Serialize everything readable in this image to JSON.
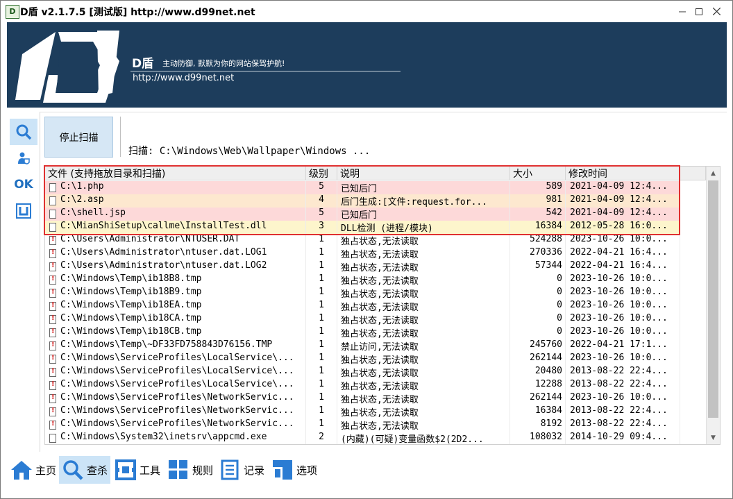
{
  "window": {
    "title": "D盾 v2.1.7.5 [测试版] http://www.d99net.net",
    "icon_text": "D"
  },
  "banner": {
    "logo_letter": "D",
    "brand": "D盾",
    "slogan": "主动防御, 默默为你的网站保驾护航!",
    "url": "http://www.d99net.net"
  },
  "sidebar": {
    "items": [
      {
        "icon": "search-icon",
        "active": true
      },
      {
        "icon": "user-shield-icon",
        "active": false
      },
      {
        "icon": "ok-icon",
        "label": "OK",
        "active": false
      },
      {
        "icon": "frame-icon",
        "active": false
      }
    ]
  },
  "scan": {
    "stop_label": "停止扫描",
    "status": "扫描: C:\\Windows\\Web\\Wallpaper\\Windows ..."
  },
  "table": {
    "columns": [
      "文件 (支持拖放目录和扫描)",
      "级别",
      "说明",
      "大小",
      "修改时间"
    ],
    "rows": [
      {
        "path": "C:\\1.php",
        "level": "5",
        "desc": "已知后门",
        "size": "589",
        "mtime": "2021-04-09 12:4...",
        "bg": "#fdd9d9",
        "warn": false
      },
      {
        "path": "C:\\2.asp",
        "level": "4",
        "desc": "后门生成:[文件:request.for...",
        "size": "981",
        "mtime": "2021-04-09 12:4...",
        "bg": "#fde8cf",
        "warn": false
      },
      {
        "path": "C:\\shell.jsp",
        "level": "5",
        "desc": "已知后门",
        "size": "542",
        "mtime": "2021-04-09 12:4...",
        "bg": "#fdd9d9",
        "warn": false
      },
      {
        "path": "C:\\MianShiSetup\\callme\\InstallTest.dll",
        "level": "3",
        "desc": "DLL检测 (进程/模块)",
        "size": "16384",
        "mtime": "2012-05-28 16:0...",
        "bg": "#fdf5cc",
        "warn": false
      },
      {
        "path": "C:\\Users\\Administrator\\NTUSER.DAT",
        "level": "1",
        "desc": "独占状态,无法读取",
        "size": "524288",
        "mtime": "2023-10-26 10:0...",
        "bg": "#ffffff",
        "warn": true
      },
      {
        "path": "C:\\Users\\Administrator\\ntuser.dat.LOG1",
        "level": "1",
        "desc": "独占状态,无法读取",
        "size": "270336",
        "mtime": "2022-04-21 16:4...",
        "bg": "#ffffff",
        "warn": true
      },
      {
        "path": "C:\\Users\\Administrator\\ntuser.dat.LOG2",
        "level": "1",
        "desc": "独占状态,无法读取",
        "size": "57344",
        "mtime": "2022-04-21 16:4...",
        "bg": "#ffffff",
        "warn": true
      },
      {
        "path": "C:\\Windows\\Temp\\ib18B8.tmp",
        "level": "1",
        "desc": "独占状态,无法读取",
        "size": "0",
        "mtime": "2023-10-26 10:0...",
        "bg": "#ffffff",
        "warn": true
      },
      {
        "path": "C:\\Windows\\Temp\\ib18B9.tmp",
        "level": "1",
        "desc": "独占状态,无法读取",
        "size": "0",
        "mtime": "2023-10-26 10:0...",
        "bg": "#ffffff",
        "warn": true
      },
      {
        "path": "C:\\Windows\\Temp\\ib18EA.tmp",
        "level": "1",
        "desc": "独占状态,无法读取",
        "size": "0",
        "mtime": "2023-10-26 10:0...",
        "bg": "#ffffff",
        "warn": true
      },
      {
        "path": "C:\\Windows\\Temp\\ib18CA.tmp",
        "level": "1",
        "desc": "独占状态,无法读取",
        "size": "0",
        "mtime": "2023-10-26 10:0...",
        "bg": "#ffffff",
        "warn": true
      },
      {
        "path": "C:\\Windows\\Temp\\ib18CB.tmp",
        "level": "1",
        "desc": "独占状态,无法读取",
        "size": "0",
        "mtime": "2023-10-26 10:0...",
        "bg": "#ffffff",
        "warn": true
      },
      {
        "path": "C:\\Windows\\Temp\\~DF33FD758843D76156.TMP",
        "level": "1",
        "desc": "禁止访问,无法读取",
        "size": "245760",
        "mtime": "2022-04-21 17:1...",
        "bg": "#ffffff",
        "warn": true
      },
      {
        "path": "C:\\Windows\\ServiceProfiles\\LocalService\\...",
        "level": "1",
        "desc": "独占状态,无法读取",
        "size": "262144",
        "mtime": "2023-10-26 10:0...",
        "bg": "#ffffff",
        "warn": true
      },
      {
        "path": "C:\\Windows\\ServiceProfiles\\LocalService\\...",
        "level": "1",
        "desc": "独占状态,无法读取",
        "size": "20480",
        "mtime": "2013-08-22 22:4...",
        "bg": "#ffffff",
        "warn": true
      },
      {
        "path": "C:\\Windows\\ServiceProfiles\\LocalService\\...",
        "level": "1",
        "desc": "独占状态,无法读取",
        "size": "12288",
        "mtime": "2013-08-22 22:4...",
        "bg": "#ffffff",
        "warn": true
      },
      {
        "path": "C:\\Windows\\ServiceProfiles\\NetworkServic...",
        "level": "1",
        "desc": "独占状态,无法读取",
        "size": "262144",
        "mtime": "2023-10-26 10:0...",
        "bg": "#ffffff",
        "warn": true
      },
      {
        "path": "C:\\Windows\\ServiceProfiles\\NetworkServic...",
        "level": "1",
        "desc": "独占状态,无法读取",
        "size": "16384",
        "mtime": "2013-08-22 22:4...",
        "bg": "#ffffff",
        "warn": true
      },
      {
        "path": "C:\\Windows\\ServiceProfiles\\NetworkServic...",
        "level": "1",
        "desc": "独占状态,无法读取",
        "size": "8192",
        "mtime": "2013-08-22 22:4...",
        "bg": "#ffffff",
        "warn": true
      },
      {
        "path": "C:\\Windows\\System32\\inetsrv\\appcmd.exe",
        "level": "2",
        "desc": "(内藏)(可疑)变量函数$2(2D2...",
        "size": "108032",
        "mtime": "2014-10-29 09:4...",
        "bg": "#ffffff",
        "warn": false
      }
    ]
  },
  "bottom_nav": [
    {
      "label": "主页",
      "icon": "home-icon",
      "active": false
    },
    {
      "label": "查杀",
      "icon": "search-icon",
      "active": true
    },
    {
      "label": "工具",
      "icon": "tools-icon",
      "active": false
    },
    {
      "label": "规则",
      "icon": "rules-icon",
      "active": false
    },
    {
      "label": "记录",
      "icon": "log-icon",
      "active": false
    },
    {
      "label": "选项",
      "icon": "options-icon",
      "active": false
    }
  ],
  "colors": {
    "banner": "#1d3d5c",
    "accent": "#2b7cd3",
    "highlight_box": "#e03030"
  }
}
